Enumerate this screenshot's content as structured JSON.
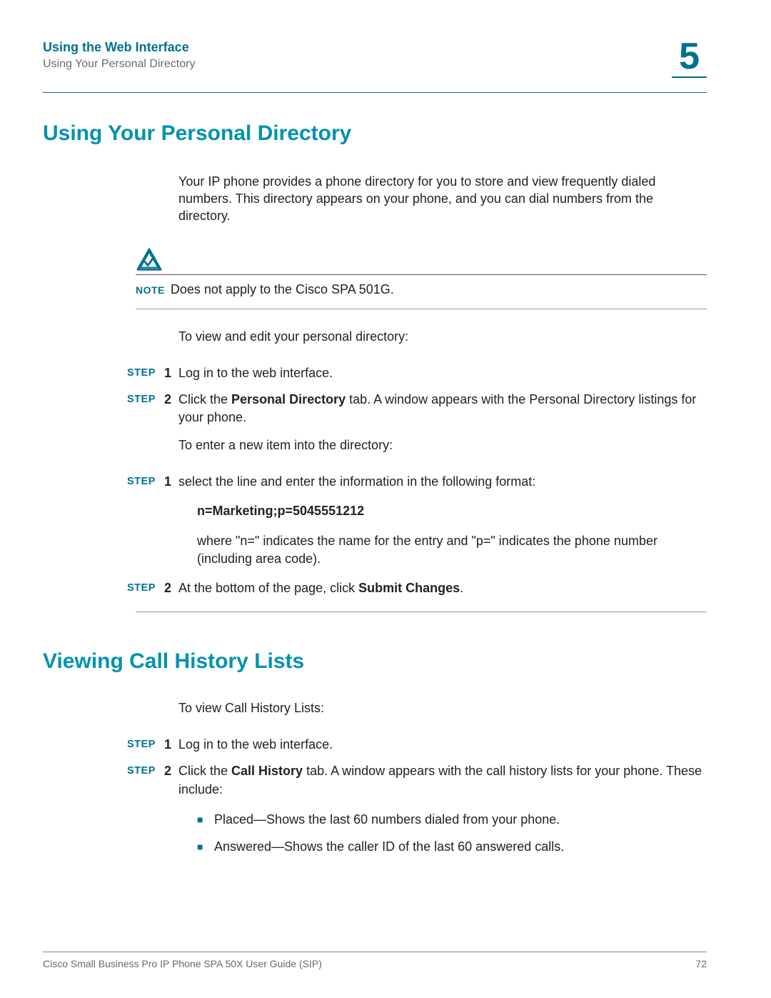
{
  "header": {
    "title": "Using the Web Interface",
    "subtitle": "Using Your Personal Directory",
    "chapter": "5"
  },
  "section1": {
    "heading": "Using Your Personal Directory",
    "intro": "Your IP phone provides a phone directory for you to store and view frequently dialed numbers. This directory appears on your phone, and you can dial numbers from the directory.",
    "note_label": "NOTE",
    "note_text": "Does not apply to the Cisco SPA 501G.",
    "lead1": "To view and edit your personal directory:",
    "step_label": "STEP",
    "steps_a": [
      {
        "n": "1",
        "text": "Log in to the web interface."
      },
      {
        "n": "2",
        "pre": "Click the ",
        "bold": "Personal Directory",
        "post": " tab. A window appears with the Personal Directory listings for your phone."
      }
    ],
    "lead2": "To enter a new item into the directory:",
    "steps_b": [
      {
        "n": "1",
        "text": "select the line and enter the information in the following format:"
      }
    ],
    "code": "n=Marketing;p=5045551212",
    "code_expl": "where \"n=\" indicates the name for the entry and \"p=\" indicates the phone number (including area code).",
    "steps_c": [
      {
        "n": "2",
        "pre": "At the bottom of the page, click ",
        "bold": "Submit Changes",
        "post": "."
      }
    ]
  },
  "section2": {
    "heading": "Viewing Call History Lists",
    "lead": "To view Call History Lists:",
    "step_label": "STEP",
    "steps": [
      {
        "n": "1",
        "text": "Log in to the web interface."
      },
      {
        "n": "2",
        "pre": "Click the ",
        "bold": "Call History",
        "post": " tab. A window appears with the call history lists for your phone. These include:"
      }
    ],
    "bullets": [
      {
        "bold": "Placed",
        "rest": "—Shows the last 60 numbers dialed from your phone."
      },
      {
        "bold": "Answered",
        "rest": "—Shows the caller ID of the last 60 answered calls."
      }
    ]
  },
  "footer": {
    "manual": "Cisco Small Business Pro IP Phone SPA 50X User Guide (SIP)",
    "page": "72"
  }
}
